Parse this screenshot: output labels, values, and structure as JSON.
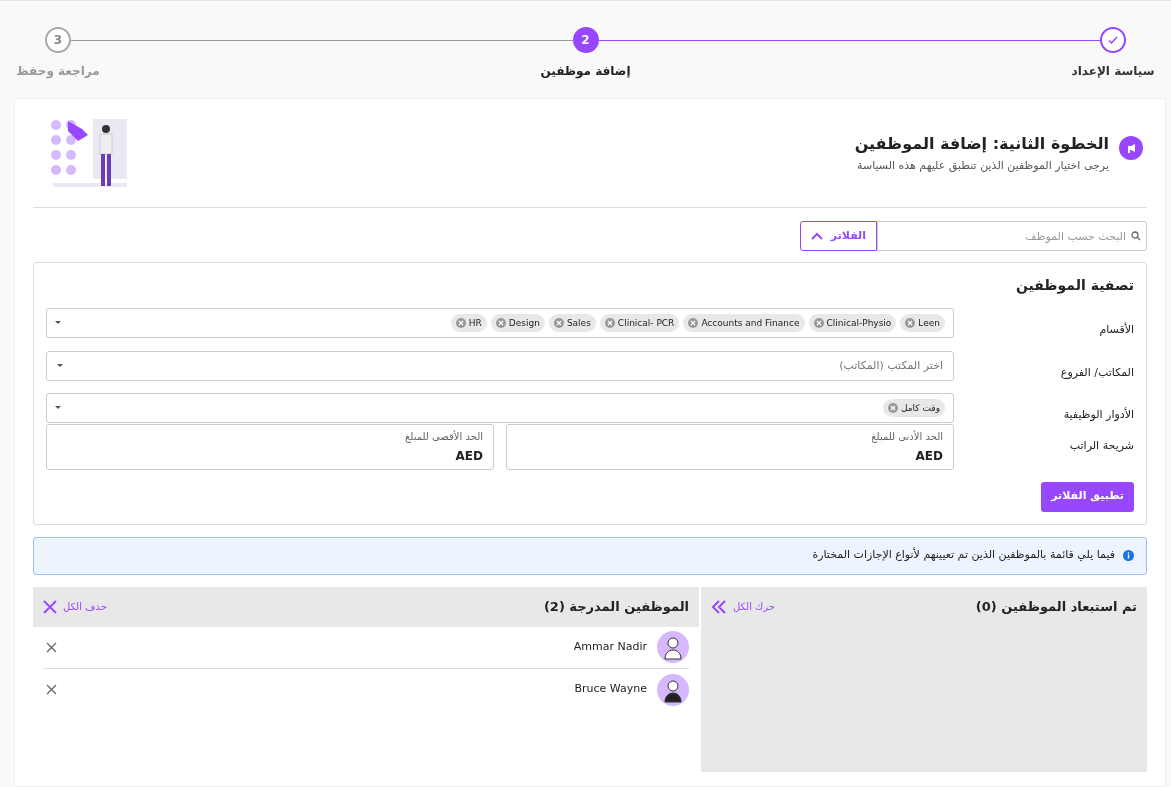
{
  "steps": [
    {
      "label": "سياسة الإعداد",
      "completed": true,
      "selected": false
    },
    {
      "number": "2",
      "label": "إضافة موظفين",
      "completed": false,
      "selected": true
    },
    {
      "number": "3",
      "label": "مراجعة وحفظ",
      "completed": false,
      "selected": false
    }
  ],
  "header": {
    "title": "الخطوة الثانية: إضافة الموظفين",
    "subtitle": "يرجى اختيار الموظفين الذين تنطبق عليهم هذه السياسة"
  },
  "search": {
    "placeholder": "البحث حسب الموظف"
  },
  "filters_button": {
    "label": "الفلاتر",
    "expanded": true
  },
  "filter_panel": {
    "title": "تصفية الموظفين",
    "rows": [
      {
        "kind": "tags",
        "label": "الأقسام",
        "tags": [
          "Leen",
          "Clinical-Physio",
          "Accounts and Finance",
          "Clinical- PCR",
          "Sales",
          "Design",
          "HR"
        ]
      },
      {
        "kind": "select",
        "label": "المكاتب/ الفروع",
        "placeholder": "اختر المكتب (المكاتب)"
      },
      {
        "kind": "tags",
        "label": "الأدوار الوظيفية",
        "tags": [
          "وقت كامل"
        ]
      },
      {
        "kind": "range",
        "label": "شريحة الراتب",
        "min": {
          "label": "الحد الأدنى للمبلغ",
          "value": "AED"
        },
        "max": {
          "label": "الحد الأقصى للمبلغ",
          "value": "AED"
        }
      }
    ],
    "apply": "تطبيق الفلاتر"
  },
  "info": "فيما يلي قائمة بالموظفين الذين تم تعيينهم لأنواع الإجازات المختارة",
  "excluded": {
    "title": "تم استبعاد الموظفين (0)",
    "action": "حرك الكل"
  },
  "included": {
    "title": "الموظفين المدرجة (2)",
    "action": "حذف الكل",
    "employees": [
      {
        "name": "Ammar Nadir"
      },
      {
        "name": "Bruce Wayne"
      }
    ]
  }
}
